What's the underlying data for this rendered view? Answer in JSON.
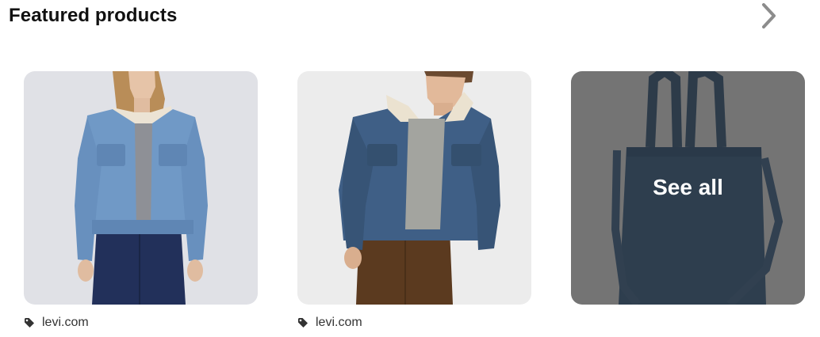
{
  "section": {
    "title": "Featured products"
  },
  "icons": {
    "next": "chevron-right-icon",
    "tag": "tag-icon"
  },
  "products": [
    {
      "image": "woman-denim-sherpa-jacket",
      "source": "levi.com"
    },
    {
      "image": "man-denim-sherpa-jacket",
      "source": "levi.com"
    }
  ],
  "see_all": {
    "image": "denim-tote-bag",
    "label": "See all"
  },
  "colors": {
    "title_text": "#111111",
    "chevron": "#8c8c8c",
    "overlay": "rgba(20,20,20,0.55)",
    "source_text": "#333333"
  }
}
